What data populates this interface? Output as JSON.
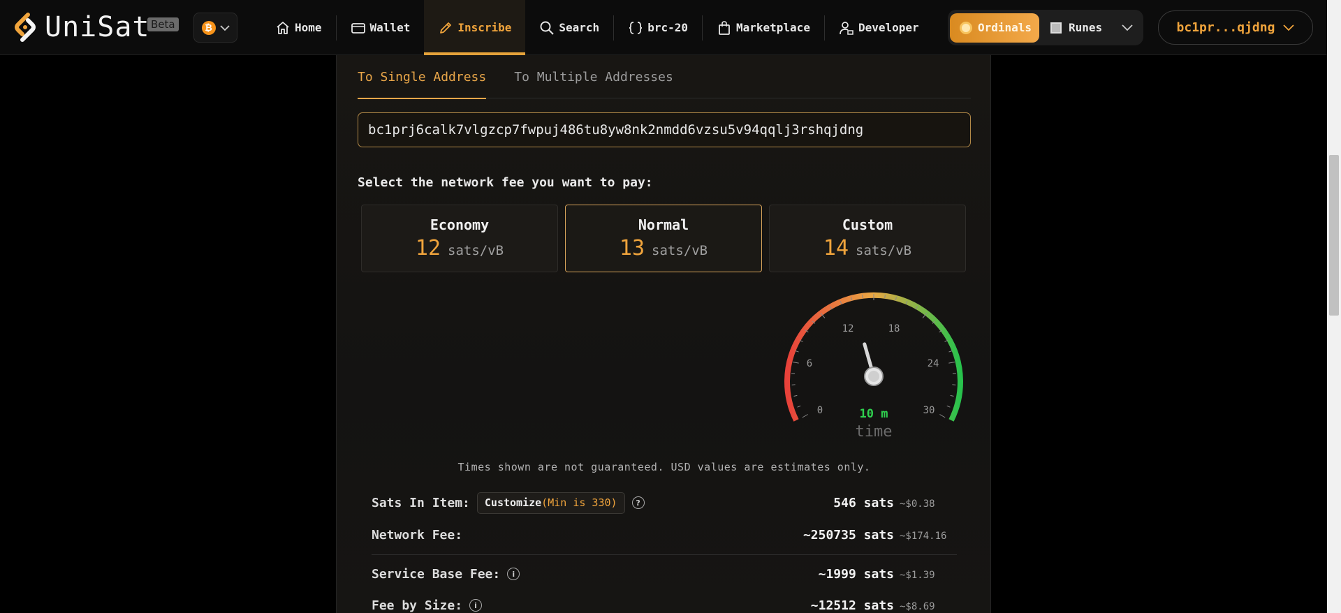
{
  "header": {
    "logo_text": "UniSat",
    "beta_label": "Beta",
    "chain_symbol": "₿",
    "nav": [
      {
        "label": "Home",
        "icon": "home-icon"
      },
      {
        "label": "Wallet",
        "icon": "wallet-icon"
      },
      {
        "label": "Inscribe",
        "icon": "pencil-icon",
        "active": true
      },
      {
        "label": "Search",
        "icon": "search-icon"
      },
      {
        "label": "brc-20",
        "icon": "braces-icon"
      },
      {
        "label": "Marketplace",
        "icon": "bag-icon"
      },
      {
        "label": "Developer",
        "icon": "developer-icon"
      }
    ],
    "toggle": {
      "ordinals": "Ordinals",
      "runes": "Runes"
    },
    "address": "bc1pr...qjdng",
    "accent": "#f0a43c"
  },
  "tabs": [
    {
      "label": "To Single Address",
      "active": true
    },
    {
      "label": "To Multiple Addresses",
      "active": false
    }
  ],
  "address_input": {
    "value": "bc1prj6calk7vlgzcp7fwpuj486tu8yw8nk2nmdd6vzsu5v94qqlj3rshqjdng"
  },
  "fee_prompt": "Select the network fee you want to pay:",
  "fees": [
    {
      "name": "Economy",
      "rate": "12",
      "unit": "sats/vB",
      "selected": false
    },
    {
      "name": "Normal",
      "rate": "13",
      "unit": "sats/vB",
      "selected": true
    },
    {
      "name": "Custom",
      "rate": "14",
      "unit": "sats/vB",
      "selected": false
    }
  ],
  "gauge": {
    "ticks": [
      "0",
      "6",
      "12",
      "18",
      "24",
      "30"
    ],
    "value": 13,
    "max": 30,
    "time_value": "10 m",
    "time_label": "time"
  },
  "disclaimer": "Times shown are not guaranteed. USD values are estimates only.",
  "summary": {
    "sats_in_item": {
      "label": "Sats In Item:",
      "customize": "Customize",
      "min": "(Min is 330)",
      "sats": "546 sats",
      "usd": "~$0.38"
    },
    "network_fee": {
      "label": "Network Fee:",
      "sats": "~250735 sats",
      "usd": "~$174.16"
    },
    "service_base_fee": {
      "label": "Service Base Fee:",
      "sats": "~1999 sats",
      "usd": "~$1.39"
    },
    "fee_by_size": {
      "label": "Fee by Size:",
      "sats": "~12512 sats",
      "usd": "~$8.69"
    }
  }
}
